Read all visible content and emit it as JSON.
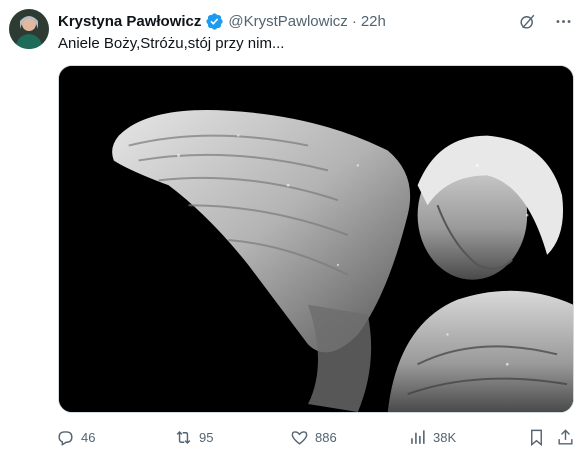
{
  "author": {
    "name": "Krystyna Pawłowicz",
    "handle": "@KrystPawlowicz",
    "separator": "·",
    "time": "22h"
  },
  "tweet": {
    "text": "Aniele Boży,Stróżu,stój przy nim..."
  },
  "media": {
    "description_icon": "angel-statue-photo"
  },
  "actions": {
    "replies": "46",
    "retweets": "95",
    "likes": "886",
    "views": "38K"
  },
  "icons": {
    "verified": "verified-badge-icon",
    "grok": "grok-icon",
    "more": "more-icon",
    "reply": "reply-icon",
    "retweet": "retweet-icon",
    "like": "heart-icon",
    "views": "views-icon",
    "bookmark": "bookmark-icon",
    "share": "share-icon"
  },
  "colors": {
    "accent": "#1d9bf0",
    "muted": "#536471",
    "text": "#0f1419"
  }
}
